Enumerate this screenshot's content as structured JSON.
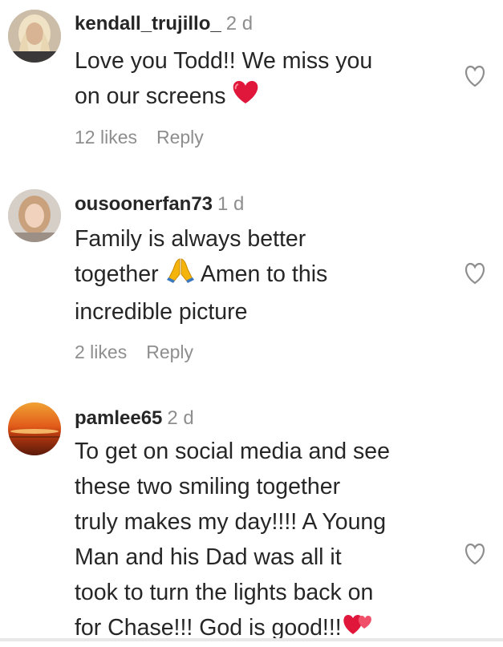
{
  "comments": [
    {
      "username": "kendall_trujillo_",
      "time": "2 d",
      "lines": [
        "Love you Todd!! We miss you",
        "on our screens"
      ],
      "likes": "12 likes",
      "reply": "Reply",
      "emoji": "red-heart-emoji"
    },
    {
      "username": "ousoonerfan73",
      "time": "1 d",
      "lines": [
        "Family is always better",
        "Amen to this",
        "incredible picture"
      ],
      "line1_prefix": "together",
      "likes": "2 likes",
      "reply": "Reply",
      "emoji": "folded-hands-emoji"
    },
    {
      "username": "pamlee65",
      "time": "2 d",
      "lines": [
        "To get on social media and see",
        "these two smiling together",
        "truly makes my day!!!! A Young",
        "Man and his Dad was all it",
        "took to turn the lights back on",
        "for Chase!!! God is good!!!"
      ],
      "emoji": "two-hearts-emoji"
    }
  ],
  "colors": {
    "text": "#262626",
    "secondary": "#8e8e8e",
    "heart": "#e0163a",
    "folded_hands": "#f5b40b"
  }
}
